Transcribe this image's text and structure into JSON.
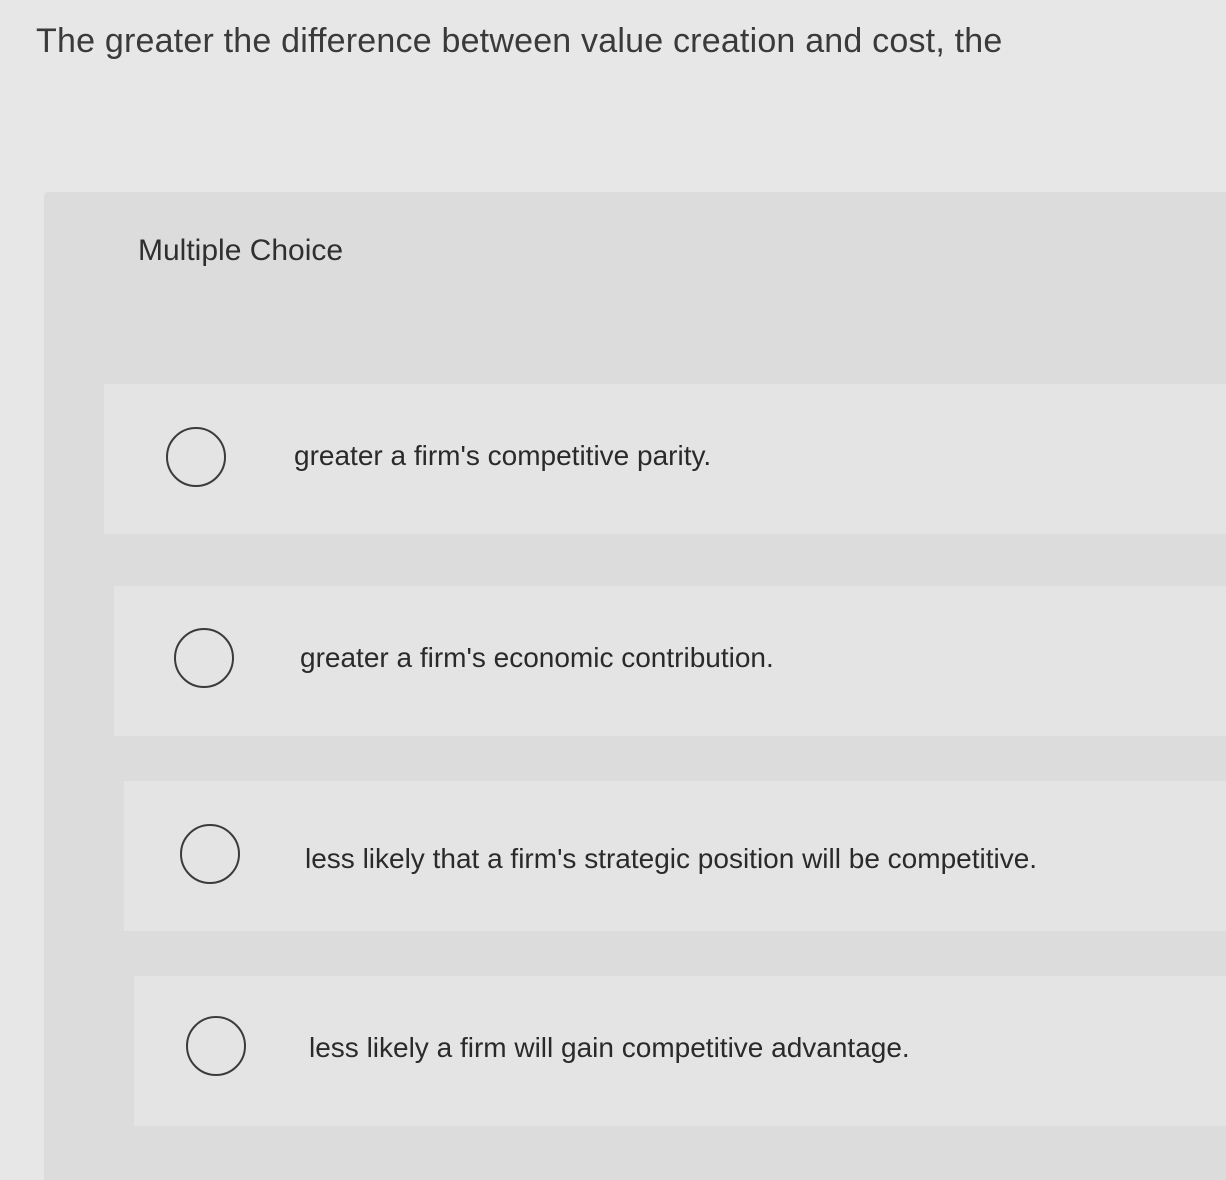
{
  "question": {
    "text": "The greater the difference between value creation and cost, the"
  },
  "section": {
    "label": "Multiple Choice"
  },
  "options": [
    {
      "label": "greater a firm's competitive parity.",
      "selected": false
    },
    {
      "label": "greater a firm's economic contribution.",
      "selected": false
    },
    {
      "label": "less likely that a firm's strategic position will be competitive.",
      "selected": false
    },
    {
      "label": "less likely a firm will gain competitive advantage.",
      "selected": false
    }
  ],
  "colors": {
    "page_background": "#e7e7e7",
    "panel_background": "#dcdcdc",
    "text": "#2a2a2a"
  }
}
